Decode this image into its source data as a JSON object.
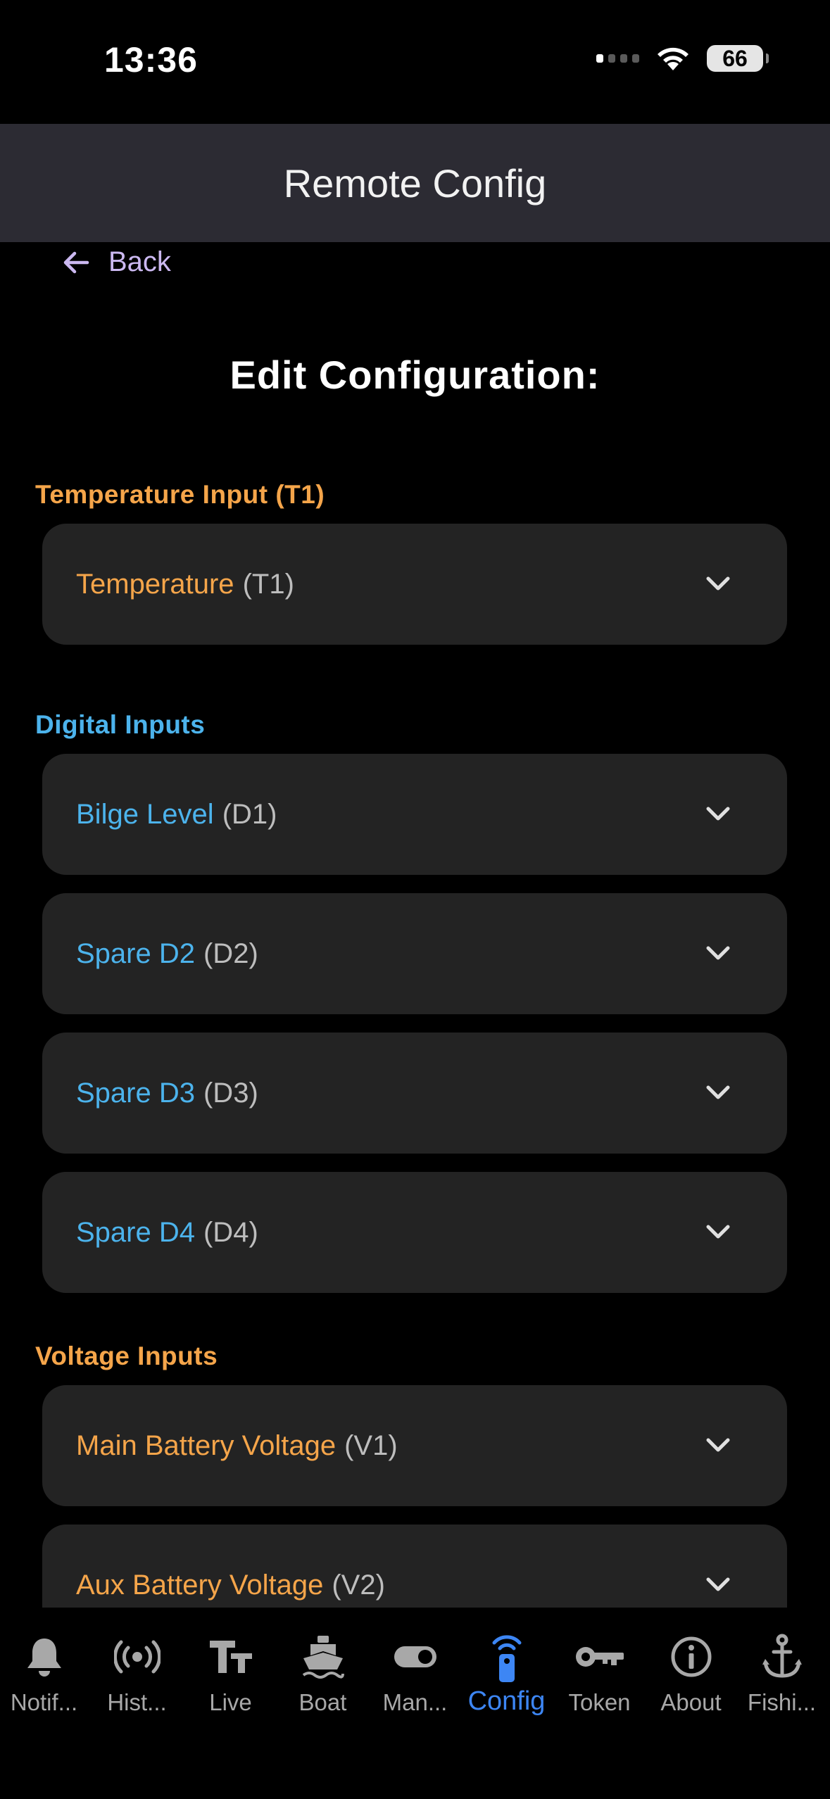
{
  "status": {
    "time": "13:36",
    "battery": "66"
  },
  "header": {
    "title": "Remote Config"
  },
  "back": {
    "label": "Back"
  },
  "page_title": "Edit Configuration:",
  "sections": {
    "temperature": {
      "label": "Temperature Input (T1)",
      "color": "#f5a54a",
      "items": [
        {
          "name": "Temperature",
          "code": "(T1)"
        }
      ]
    },
    "digital": {
      "label": "Digital Inputs",
      "color": "#4cb3ec",
      "items": [
        {
          "name": "Bilge Level",
          "code": "(D1)"
        },
        {
          "name": "Spare D2",
          "code": "(D2)"
        },
        {
          "name": "Spare D3",
          "code": "(D3)"
        },
        {
          "name": "Spare D4",
          "code": "(D4)"
        }
      ]
    },
    "voltage": {
      "label": "Voltage Inputs",
      "color": "#f5a54a",
      "items": [
        {
          "name": "Main Battery Voltage",
          "code": "(V1)"
        },
        {
          "name": "Aux Battery Voltage",
          "code": "(V2)"
        }
      ]
    }
  },
  "nav": {
    "items": [
      {
        "label": "Notif...",
        "icon": "bell-icon"
      },
      {
        "label": "Hist...",
        "icon": "broadcast-icon"
      },
      {
        "label": "Live",
        "icon": "text-size-icon"
      },
      {
        "label": "Boat",
        "icon": "boat-icon"
      },
      {
        "label": "Man...",
        "icon": "toggle-icon"
      },
      {
        "label": "Config",
        "icon": "remote-icon",
        "active": true
      },
      {
        "label": "Token",
        "icon": "key-icon"
      },
      {
        "label": "About",
        "icon": "info-icon"
      },
      {
        "label": "Fishi...",
        "icon": "anchor-icon"
      }
    ],
    "active_color": "#3d86f4",
    "inactive_color": "#a8a8a8"
  }
}
